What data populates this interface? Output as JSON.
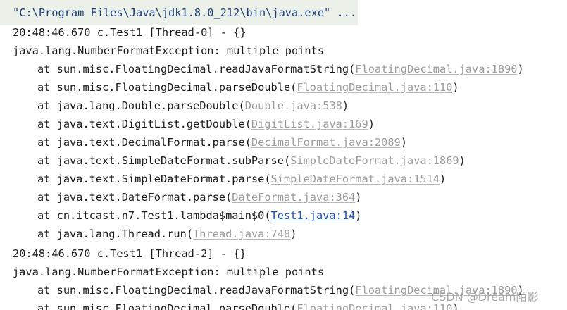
{
  "console": {
    "command": "\"C:\\Program Files\\Java\\jdk1.8.0_212\\bin\\java.exe\" ...",
    "block1": {
      "log_line": "20:48:46.670 c.Test1 [Thread-0] - {}",
      "exception": "java.lang.NumberFormatException: multiple points",
      "frames": [
        {
          "method": "at sun.misc.FloatingDecimal.readJavaFormatString(",
          "source": "FloatingDecimal.java:1890"
        },
        {
          "method": "at sun.misc.FloatingDecimal.parseDouble(",
          "source": "FloatingDecimal.java:110"
        },
        {
          "method": "at java.lang.Double.parseDouble(",
          "source": "Double.java:538"
        },
        {
          "method": "at java.text.DigitList.getDouble(",
          "source": "DigitList.java:169"
        },
        {
          "method": "at java.text.DecimalFormat.parse(",
          "source": "DecimalFormat.java:2089"
        },
        {
          "method": "at java.text.SimpleDateFormat.subParse(",
          "source": "SimpleDateFormat.java:1869"
        },
        {
          "method": "at java.text.SimpleDateFormat.parse(",
          "source": "SimpleDateFormat.java:1514"
        },
        {
          "method": "at java.text.DateFormat.parse(",
          "source": "DateFormat.java:364"
        },
        {
          "method": "at cn.itcast.n7.Test1.lambda$main$0(",
          "source": "Test1.java:14"
        },
        {
          "method": "at java.lang.Thread.run(",
          "source": "Thread.java:748"
        }
      ]
    },
    "block2": {
      "log_line": "20:48:46.670 c.Test1 [Thread-2] - {}",
      "exception": "java.lang.NumberFormatException: multiple points",
      "frames": [
        {
          "method": "at sun.misc.FloatingDecimal.readJavaFormatString(",
          "source": "FloatingDecimal.java:1890"
        },
        {
          "method": "at sun.misc.FloatingDecimal.parseDouble(",
          "source": "FloatingDecimal.java:110"
        }
      ]
    },
    "close_paren": ")"
  },
  "watermark": "CSDN @Dream陌影",
  "colors": {
    "command_bar_bg": "#ebf1e8",
    "command_text": "#1b3d7a",
    "library_link": "#9c9c9c",
    "user_link": "#1a4fb8",
    "text": "#1b1b1b"
  }
}
